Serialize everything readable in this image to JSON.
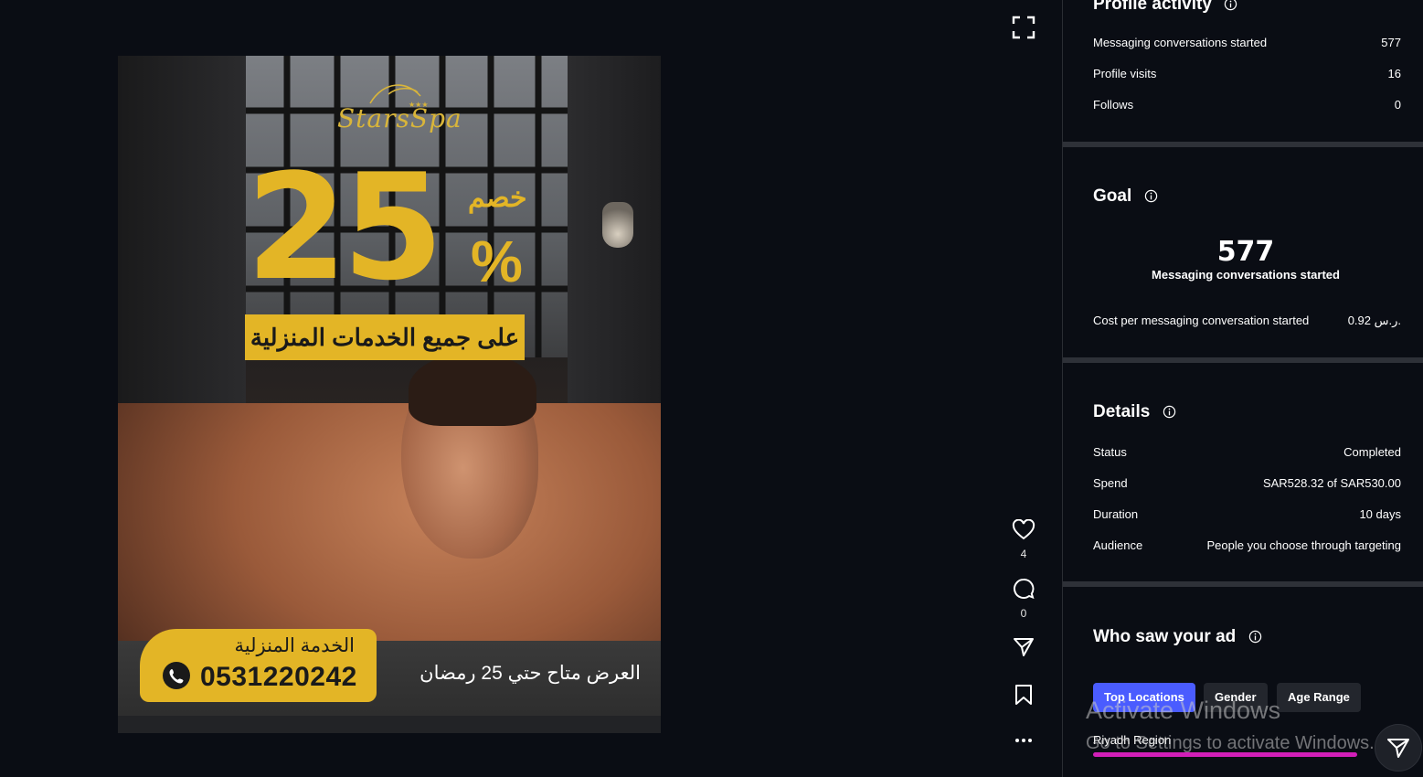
{
  "ad": {
    "logo_text": "StarsSpa",
    "discount_word": "خصم",
    "discount_number": "25",
    "percent_sign": "%",
    "banner_text": "على جميع الخدمات المنزلية",
    "home_service_label": "الخدمة المنزلية",
    "phone_number": "0531220242",
    "offer_text": "العرض متاح حتي 25 رمضان",
    "accent_color": "#e3b526"
  },
  "actions": {
    "likes_count": "4",
    "comments_count": "0"
  },
  "profile_activity": {
    "title": "Profile activity",
    "rows": [
      {
        "label": "Messaging conversations started",
        "value": "577"
      },
      {
        "label": "Profile visits",
        "value": "16"
      },
      {
        "label": "Follows",
        "value": "0"
      }
    ]
  },
  "goal": {
    "title": "Goal",
    "number": "577",
    "subtitle": "Messaging conversations started",
    "cost_label": "Cost per messaging conversation started",
    "cost_value": "0.92 ر.س."
  },
  "details": {
    "title": "Details",
    "rows": [
      {
        "label": "Status",
        "value": "Completed"
      },
      {
        "label": "Spend",
        "value": "SAR528.32 of SAR530.00"
      },
      {
        "label": "Duration",
        "value": "10 days"
      },
      {
        "label": "Audience",
        "value": "People you choose through targeting"
      }
    ]
  },
  "who_saw": {
    "title": "Who saw your ad",
    "tabs": [
      {
        "label": "Top Locations",
        "active": true
      },
      {
        "label": "Gender",
        "active": false
      },
      {
        "label": "Age Range",
        "active": false
      }
    ],
    "locations": [
      {
        "name": "Riyadh Region",
        "share": 0.85
      }
    ],
    "bar_color": "#d21fb8",
    "active_tab_color": "#4a5cff"
  },
  "watermark": {
    "line1": "Activate Windows",
    "line2": "Go to Settings to activate Windows."
  }
}
